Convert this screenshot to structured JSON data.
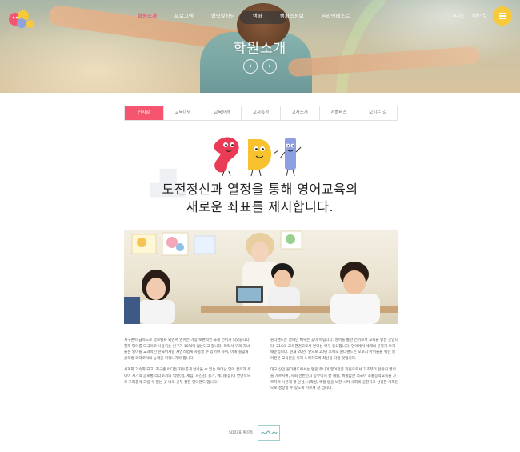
{
  "header": {
    "logo": {
      "name": "sdi-logo-icon"
    },
    "nav": [
      {
        "label": "학원소개",
        "active": true
      },
      {
        "label": "프로그램",
        "active": false
      },
      {
        "label": "협력및상담",
        "active": false
      },
      {
        "label": "캠퍼",
        "active": false
      },
      {
        "label": "캠퍼스정보",
        "active": false
      },
      {
        "label": "온라인테스트",
        "active": false
      }
    ],
    "util": {
      "login": "로그인",
      "join": "회원가입"
    },
    "menu_icon": "hamburger-menu-icon",
    "accent_color": "#f5556f",
    "menu_color": "#f7c93b"
  },
  "hero": {
    "title": "학원소개",
    "prev_icon": "chevron-left-icon",
    "next_icon": "chevron-right-icon"
  },
  "tabs": [
    {
      "label": "인사말",
      "active": true
    },
    {
      "label": "교육이념",
      "active": false
    },
    {
      "label": "교육환경",
      "active": false
    },
    {
      "label": "교사특성",
      "active": false
    },
    {
      "label": "교사소개",
      "active": false
    },
    {
      "label": "셔틀버스",
      "active": false
    },
    {
      "label": "오시는 길",
      "active": false
    }
  ],
  "intro": {
    "headline_line1": "도전정신과 열정을 통해 영어교육의",
    "headline_line2": "새로운 좌표를 제시합니다."
  },
  "body": {
    "left": [
      "지구촌이 급속도로 글로벌화 되면서 영어는 가장 보편적인 국제 언어가 되었습니다. 현재 영어를 모국어로 사용하는 인구가 10억이 넘는다고 합니다. 따라서 우리 자녀들은 영어를 교과목인 한국어처럼 자연스럽게 사용할 수 있어야 하며, 이에 걸맞게 글로벌 리더로서의 능력을 키워나가야 합니다.",
      "세계화 가속화 되고, 지구촌 어디든 자유롭게 넘나들 수 있는 뛰어난 영어 실력과 주니어 시기의 글로벌 리더로서의 역량(협, 세심, 자신감, 용기, 배기통침)이 연단적으로 조화롭게 그릴 수 있는 곳 바로 공부 잘한 연다랜드 입니다."
    ],
    "right": [
      "원더랜드는 영어만 배우는 곳이 아닙니다. 영어를 통한 언어로서 교육을 받는 곳입니다. 21C의 교육편견고로서 언어는 매우 중요합니다. 언어에서 세계의 문화가 보기 때문입니다. 현재 20년, 앞으로 20년 후에도 원더랜드는 오로지 아이들을 위한 영어전문 교육만을 위해 노력하도록 최선을 다할 것입니다.",
      "대구 상인 원더랜드에서는 명문 주니어 영어전문 학원으로서 기초부터 탄탄히 영어를 가르치며, 시회 전반인지 공부이해 잘 해왔, 특별함한 외국어 소통능력교육을 가르치며 시간계 팔 인성, 시착성, 예절 등을 보한 시켜 사회에 공헌하고 성실한 사회인으로 성장할 수 있도록 가르쳐 갈 겁니다."
    ]
  },
  "signature": {
    "label": "SDI대표 황길동",
    "icon": "handwritten-signature-icon"
  }
}
